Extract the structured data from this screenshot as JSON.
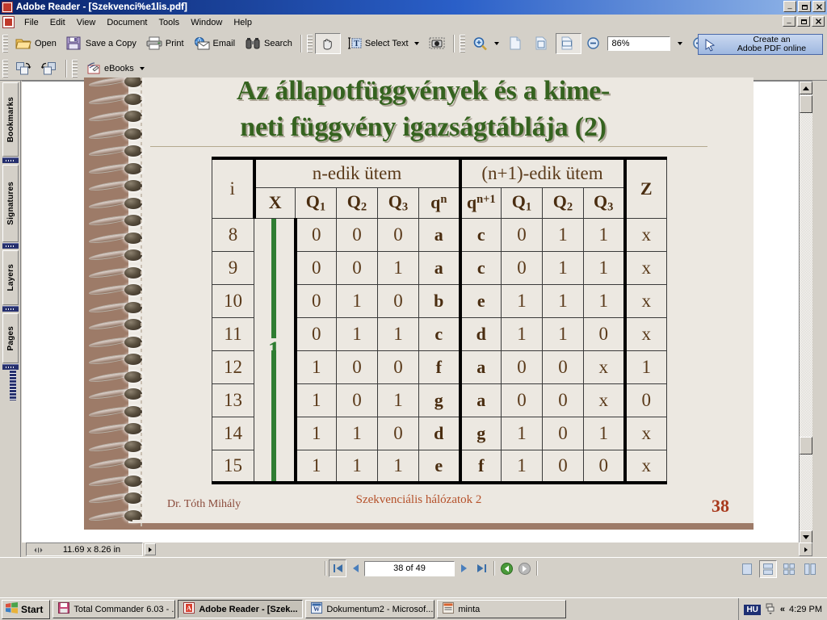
{
  "window": {
    "title": "Adobe Reader - [Szekvenci%e1lis.pdf]",
    "minimize": "_",
    "maximize": "❐",
    "close": "✕"
  },
  "menu": {
    "items": [
      "File",
      "Edit",
      "View",
      "Document",
      "Tools",
      "Window",
      "Help"
    ]
  },
  "toolbar_main": {
    "buttons": [
      {
        "label": "Open",
        "icon": "open-folder-icon"
      },
      {
        "label": "Save a Copy",
        "icon": "floppy-disk-icon"
      },
      {
        "label": "Print",
        "icon": "printer-icon"
      },
      {
        "label": "Email",
        "icon": "email-globe-icon"
      },
      {
        "label": "Search",
        "icon": "binoculars-icon"
      }
    ],
    "hand_tool": "hand-icon",
    "select_text": "Select Text",
    "select_text_icon": "text-select-icon",
    "snapshot_icon": "snapshot-camera-icon",
    "zoom_icon": "zoom-in-magnifier-icon",
    "page_layout_icons": [
      "actual-size-icon",
      "fit-page-icon",
      "fit-width-icon"
    ],
    "zoom_out_icon": "zoom-out-icon",
    "zoom_value": "86%",
    "zoom_in_icon": "zoom-in-icon"
  },
  "toolbar_secondary": {
    "rotate_cw_icon": "rotate-clockwise-icon",
    "rotate_ccw_icon": "rotate-counterclockwise-icon",
    "ebooks_label": "eBooks",
    "ebooks_icon": "ebooks-icon"
  },
  "create_pdf": {
    "line1": "Create an",
    "line2": "Adobe PDF online",
    "icon": "arrow-cursor-icon"
  },
  "nav_tabs": [
    {
      "label": "Bookmarks"
    },
    {
      "label": "Signatures"
    },
    {
      "label": "Layers"
    },
    {
      "label": "Pages"
    }
  ],
  "slide": {
    "title_line1": "Az állapotfüggvények és a kime-",
    "title_line2": "neti függvény igazságtáblája (2)",
    "annotation_value": "1",
    "footer_author": "Dr. Tóth Mihály",
    "footer_center": "Szekvenciális hálózatok 2",
    "footer_page": "38"
  },
  "table": {
    "col_i": "i",
    "group_left": "n-edik ütem",
    "group_right": "(n+1)-edik ütem",
    "col_z": "Z",
    "sub_headers_left": [
      {
        "base": "X",
        "sub": "",
        "sup": ""
      },
      {
        "base": "Q",
        "sub": "1",
        "sup": ""
      },
      {
        "base": "Q",
        "sub": "2",
        "sup": ""
      },
      {
        "base": "Q",
        "sub": "3",
        "sup": ""
      },
      {
        "base": "q",
        "sub": "",
        "sup": "n"
      }
    ],
    "sub_headers_right": [
      {
        "base": "q",
        "sub": "",
        "sup": "n+1"
      },
      {
        "base": "Q",
        "sub": "1",
        "sup": ""
      },
      {
        "base": "Q",
        "sub": "2",
        "sup": ""
      },
      {
        "base": "Q",
        "sub": "3",
        "sup": ""
      }
    ],
    "rows": [
      {
        "i": "8",
        "Q1n": "0",
        "Q2n": "0",
        "Q3n": "0",
        "qn": "a",
        "qn1": "c",
        "Q1n1": "0",
        "Q2n1": "1",
        "Q3n1": "1",
        "Z": "x"
      },
      {
        "i": "9",
        "Q1n": "0",
        "Q2n": "0",
        "Q3n": "1",
        "qn": "a",
        "qn1": "c",
        "Q1n1": "0",
        "Q2n1": "1",
        "Q3n1": "1",
        "Z": "x"
      },
      {
        "i": "10",
        "Q1n": "0",
        "Q2n": "1",
        "Q3n": "0",
        "qn": "b",
        "qn1": "e",
        "Q1n1": "1",
        "Q2n1": "1",
        "Q3n1": "1",
        "Z": "x"
      },
      {
        "i": "11",
        "Q1n": "0",
        "Q2n": "1",
        "Q3n": "1",
        "qn": "c",
        "qn1": "d",
        "Q1n1": "1",
        "Q2n1": "1",
        "Q3n1": "0",
        "Z": "x"
      },
      {
        "i": "12",
        "Q1n": "1",
        "Q2n": "0",
        "Q3n": "0",
        "qn": "f",
        "qn1": "a",
        "Q1n1": "0",
        "Q2n1": "0",
        "Q3n1": "x",
        "Z": "1"
      },
      {
        "i": "13",
        "Q1n": "1",
        "Q2n": "0",
        "Q3n": "1",
        "qn": "g",
        "qn1": "a",
        "Q1n1": "0",
        "Q2n1": "0",
        "Q3n1": "x",
        "Z": "0"
      },
      {
        "i": "14",
        "Q1n": "1",
        "Q2n": "1",
        "Q3n": "0",
        "qn": "d",
        "qn1": "g",
        "Q1n1": "1",
        "Q2n1": "0",
        "Q3n1": "1",
        "Z": "x"
      },
      {
        "i": "15",
        "Q1n": "1",
        "Q2n": "1",
        "Q3n": "1",
        "qn": "e",
        "qn1": "f",
        "Q1n1": "1",
        "Q2n1": "0",
        "Q3n1": "0",
        "Z": "x"
      }
    ]
  },
  "status": {
    "page_size": "11.69 x 8.26 in"
  },
  "navbar": {
    "first_page_icon": "first-page-icon",
    "prev_page_icon": "previous-page-icon",
    "page_indicator": "38 of 49",
    "next_page_icon": "next-page-icon",
    "last_page_icon": "last-page-icon",
    "back_icon": "go-back-icon",
    "forward_icon": "go-forward-icon",
    "view_single_icon": "single-page-view-icon",
    "view_continuous_icon": "continuous-view-icon",
    "view_facing_icon": "facing-pages-view-icon",
    "view_continuous_facing_icon": "continuous-facing-view-icon"
  },
  "taskbar": {
    "start": "Start",
    "items": [
      {
        "label": "Total Commander 6.03 - ...",
        "icon": "total-commander-icon",
        "active": false
      },
      {
        "label": "Adobe Reader - [Szek...",
        "icon": "adobe-reader-icon",
        "active": true
      },
      {
        "label": "Dokumentum2 - Microsof...",
        "icon": "word-icon",
        "active": false
      },
      {
        "label": "minta",
        "icon": "minta-icon",
        "active": false
      }
    ],
    "language": "HU",
    "clock": "4:29 PM",
    "expand_icon": "show-hidden-icons-icon",
    "network_icon": "network-icon"
  },
  "colors": {
    "titlebar_start": "#0a246a",
    "chrome": "#d4d0c8",
    "slide_bg": "#ece8e1",
    "slide_border": "#9d7b68",
    "title_green": "#35631f",
    "table_text": "#5a3a1a",
    "annotation_green": "#2f7d32",
    "footer_red": "#b5512a"
  }
}
